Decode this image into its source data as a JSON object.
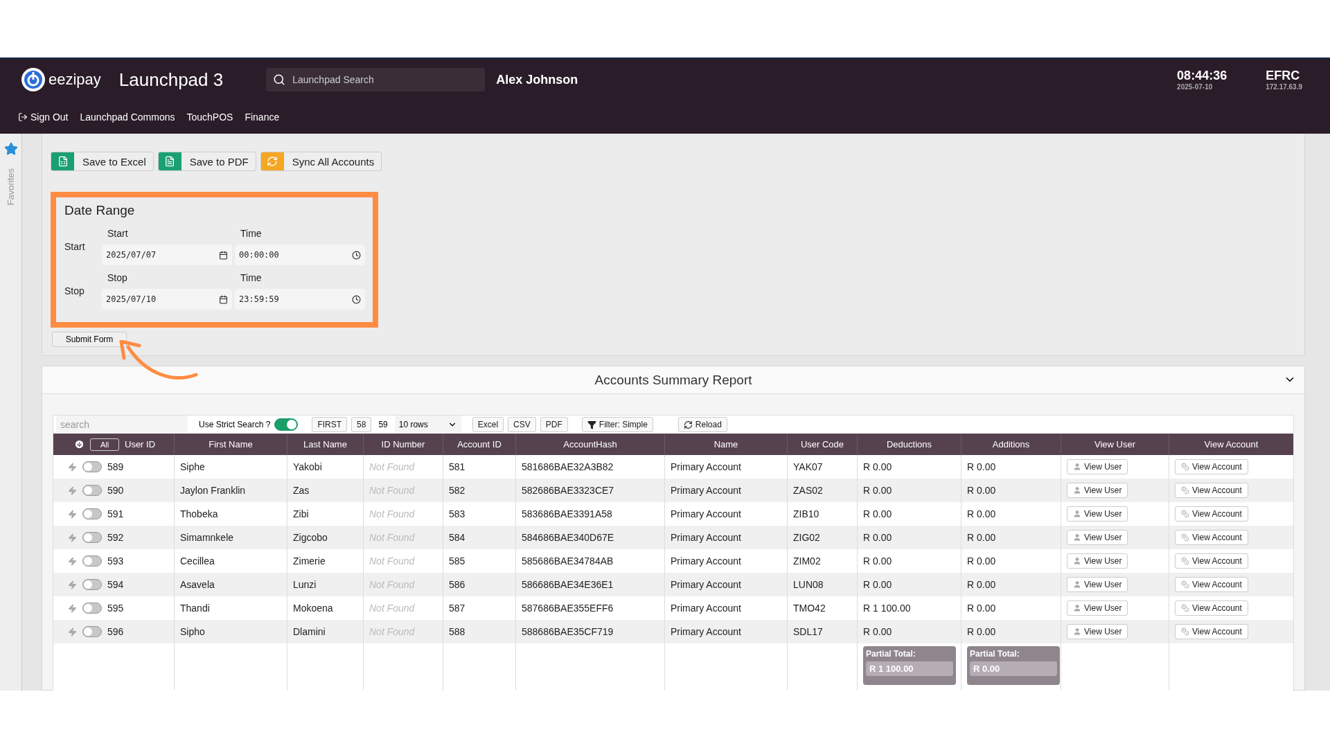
{
  "header": {
    "logo_text": "eezipay",
    "app_title": "Launchpad 3",
    "search": {
      "placeholder": "Launchpad Search"
    },
    "user": "Alex Johnson",
    "time": "08:44:36",
    "date": "2025-07-10",
    "site": "EFRC",
    "ip": "172.17.63.9"
  },
  "nav": [
    {
      "label": "Sign Out",
      "kind": "signout"
    },
    {
      "label": "Launchpad Commons",
      "kind": "link"
    },
    {
      "label": "TouchPOS",
      "kind": "link"
    },
    {
      "label": "Finance",
      "kind": "link"
    }
  ],
  "sidebar": {
    "label": "Favorites"
  },
  "controls": {
    "buttons": [
      {
        "label": "Save to Excel",
        "kind": "excel"
      },
      {
        "label": "Save to PDF",
        "kind": "pdf"
      },
      {
        "label": "Sync All Accounts",
        "kind": "sync"
      }
    ],
    "date_range": {
      "title": "Date Range",
      "highlighted": true,
      "rows": [
        {
          "row_label": "Start",
          "date_label": "Start",
          "date_value": "2025/07/07",
          "time_label": "Time",
          "time_value": "00:00:00"
        },
        {
          "row_label": "Stop",
          "date_label": "Stop",
          "date_value": "2025/07/10",
          "time_label": "Time",
          "time_value": "23:59:59"
        }
      ]
    },
    "submit": "Submit Form"
  },
  "report": {
    "title": "Accounts Summary Report",
    "expanded": true,
    "toolbar": {
      "search": {
        "placeholder": "search"
      },
      "strict_search": {
        "label": "Use Strict Search ?",
        "on": true
      },
      "first": "FIRST",
      "pages": [
        {
          "label": "58",
          "selected": false
        },
        {
          "label": "59",
          "selected": true
        }
      ],
      "rows_select": "10 rows",
      "exports": [
        "Excel",
        "CSV",
        "PDF"
      ],
      "filter": "Filter: Simple",
      "reload": "Reload"
    },
    "select_all": "All",
    "columns": [
      "User ID",
      "First Name",
      "Last Name",
      "ID Number",
      "Account ID",
      "AccountHash",
      "Name",
      "User Code",
      "Deductions",
      "Additions",
      "View User",
      "View Account"
    ],
    "rows": [
      {
        "user_id": "589",
        "enabled": false,
        "first_name": "Siphe",
        "last_name": "Yakobi",
        "id_number": "Not Found",
        "account_id": "581",
        "account_hash": "581686BAE32A3B82",
        "name": "Primary Account",
        "user_code": "YAK07",
        "deductions": "R 0.00",
        "additions": "R 0.00",
        "view_user": "View User",
        "view_account": "View Account"
      },
      {
        "user_id": "590",
        "enabled": false,
        "first_name": "Jaylon Franklin",
        "last_name": "Zas",
        "id_number": "Not Found",
        "account_id": "582",
        "account_hash": "582686BAE3323CE7",
        "name": "Primary Account",
        "user_code": "ZAS02",
        "deductions": "R 0.00",
        "additions": "R 0.00",
        "view_user": "View User",
        "view_account": "View Account"
      },
      {
        "user_id": "591",
        "enabled": false,
        "first_name": "Thobeka",
        "last_name": "Zibi",
        "id_number": "Not Found",
        "account_id": "583",
        "account_hash": "583686BAE3391A58",
        "name": "Primary Account",
        "user_code": "ZIB10",
        "deductions": "R 0.00",
        "additions": "R 0.00",
        "view_user": "View User",
        "view_account": "View Account"
      },
      {
        "user_id": "592",
        "enabled": false,
        "first_name": "Simamnkele",
        "last_name": "Zigcobo",
        "id_number": "Not Found",
        "account_id": "584",
        "account_hash": "584686BAE340D67E",
        "name": "Primary Account",
        "user_code": "ZIG02",
        "deductions": "R 0.00",
        "additions": "R 0.00",
        "view_user": "View User",
        "view_account": "View Account"
      },
      {
        "user_id": "593",
        "enabled": false,
        "first_name": "Cecillea",
        "last_name": "Zimerie",
        "id_number": "Not Found",
        "account_id": "585",
        "account_hash": "585686BAE34784AB",
        "name": "Primary Account",
        "user_code": "ZIM02",
        "deductions": "R 0.00",
        "additions": "R 0.00",
        "view_user": "View User",
        "view_account": "View Account"
      },
      {
        "user_id": "594",
        "enabled": false,
        "first_name": "Asavela",
        "last_name": "Lunzi",
        "id_number": "Not Found",
        "account_id": "586",
        "account_hash": "586686BAE34E36E1",
        "name": "Primary Account",
        "user_code": "LUN08",
        "deductions": "R 0.00",
        "additions": "R 0.00",
        "view_user": "View User",
        "view_account": "View Account"
      },
      {
        "user_id": "595",
        "enabled": false,
        "first_name": "Thandi",
        "last_name": "Mokoena",
        "id_number": "Not Found",
        "account_id": "587",
        "account_hash": "587686BAE355EFF6",
        "name": "Primary Account",
        "user_code": "TMO42",
        "deductions": "R 1 100.00",
        "additions": "R 0.00",
        "view_user": "View User",
        "view_account": "View Account"
      },
      {
        "user_id": "596",
        "enabled": false,
        "first_name": "Sipho",
        "last_name": "Dlamini",
        "id_number": "Not Found",
        "account_id": "588",
        "account_hash": "588686BAE35CF719",
        "name": "Primary Account",
        "user_code": "SDL17",
        "deductions": "R 0.00",
        "additions": "R 0.00",
        "view_user": "View User",
        "view_account": "View Account"
      }
    ],
    "totals": [
      {
        "label": "Partial Total:",
        "value": "R 1 100.00"
      },
      {
        "label": "Partial Total:",
        "value": "R 0.00"
      }
    ]
  }
}
